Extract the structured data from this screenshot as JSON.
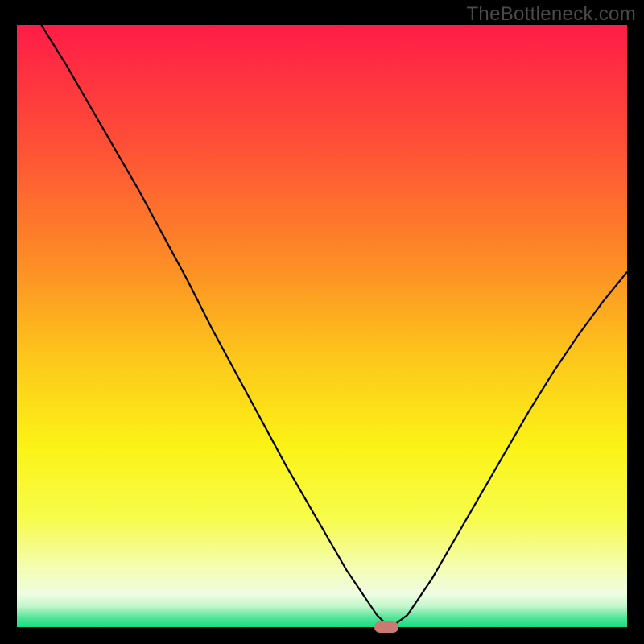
{
  "attribution": "TheBottleneck.com",
  "chart_data": {
    "type": "line",
    "title": "",
    "xlabel": "",
    "ylabel": "",
    "xlim": [
      0,
      100
    ],
    "ylim": [
      0,
      100
    ],
    "background_gradient": {
      "stops": [
        {
          "offset": 0.0,
          "color": "#ff1c47"
        },
        {
          "offset": 0.2,
          "color": "#fe5036"
        },
        {
          "offset": 0.4,
          "color": "#fd8e25"
        },
        {
          "offset": 0.55,
          "color": "#fdc61b"
        },
        {
          "offset": 0.7,
          "color": "#fbf316"
        },
        {
          "offset": 0.82,
          "color": "#f7fc4b"
        },
        {
          "offset": 0.9,
          "color": "#f4fdb0"
        },
        {
          "offset": 0.945,
          "color": "#eefde2"
        },
        {
          "offset": 0.965,
          "color": "#c3f7cb"
        },
        {
          "offset": 0.985,
          "color": "#4ee597"
        },
        {
          "offset": 1.0,
          "color": "#17dd86"
        }
      ]
    },
    "series": [
      {
        "name": "bottleneck-curve",
        "color": "#000000",
        "x": [
          4.0,
          8.0,
          12.0,
          16.0,
          20.0,
          24.0,
          28.0,
          32.0,
          36.0,
          40.0,
          44.0,
          48.0,
          52.0,
          54.0,
          56.0,
          58.0,
          59.0,
          60.0,
          61.0,
          62.0,
          64.0,
          68.0,
          72.0,
          76.0,
          80.0,
          84.0,
          88.0,
          92.0,
          96.0,
          100.0
        ],
        "y": [
          100.0,
          93.5,
          86.5,
          79.5,
          72.5,
          65.0,
          57.5,
          49.5,
          42.0,
          34.5,
          27.0,
          20.0,
          13.0,
          9.5,
          6.5,
          3.5,
          2.0,
          1.0,
          0.5,
          0.5,
          2.0,
          8.0,
          15.0,
          22.0,
          29.0,
          36.0,
          42.5,
          48.5,
          54.0,
          59.0
        ]
      }
    ],
    "marker": {
      "x": 60.5,
      "y": 0.0,
      "color": "#cb7a72"
    }
  }
}
